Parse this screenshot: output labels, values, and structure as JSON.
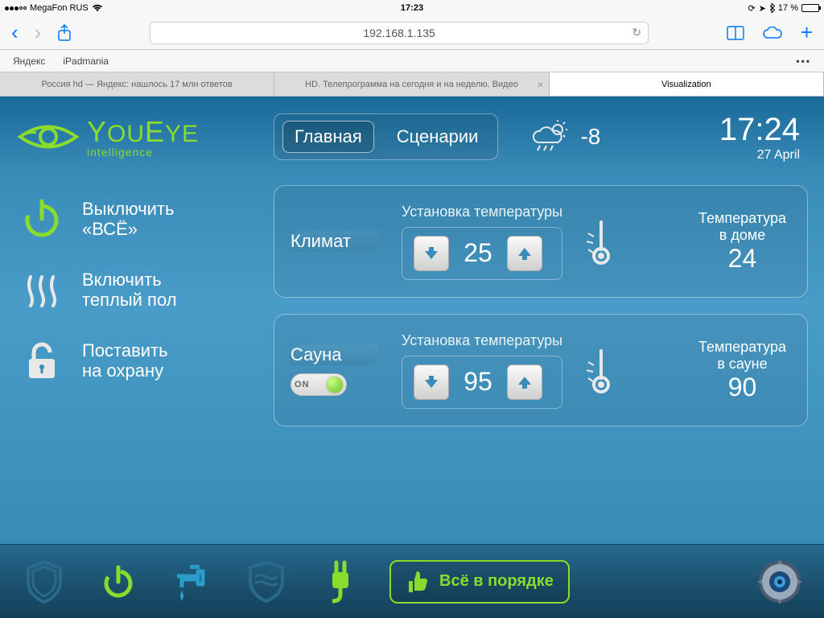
{
  "status_bar": {
    "carrier": "MegaFon RUS",
    "time": "17:23",
    "battery_pct": "17 %"
  },
  "safari": {
    "url": "192.168.1.135",
    "bookmarks": [
      "Яндекс",
      "iPadmania"
    ],
    "tabs": [
      {
        "title": "Россия hd — Яндекс: нашлось 17 млн ответов",
        "active": false
      },
      {
        "title": "HD. Телепрограмма на сегодня и на неделю. Видео",
        "active": false
      },
      {
        "title": "Visualization",
        "active": true
      }
    ]
  },
  "app": {
    "logo_top": "YouEye",
    "logo_sub": "intelligence",
    "nav": {
      "main": "Главная",
      "scenarios": "Сценарии"
    },
    "weather_temp": "-8",
    "clock_time": "17:24",
    "clock_date": "27 April",
    "sidebar": {
      "off_all_l1": "Выключить",
      "off_all_l2": "«ВСЁ»",
      "floor_l1": "Включить",
      "floor_l2": "теплый пол",
      "arm_l1": "Поставить",
      "arm_l2": "на охрану"
    },
    "climate": {
      "tab": "Климат",
      "setpoint_label": "Установка температуры",
      "setpoint": "25",
      "house_label1": "Температура",
      "house_label2": "в доме",
      "house_value": "24"
    },
    "sauna": {
      "tab": "Сауна",
      "toggle_label": "ON",
      "setpoint_label": "Установка температуры",
      "setpoint": "95",
      "label1": "Температура",
      "label2": "в сауне",
      "value": "90"
    },
    "status_ok": "Всё в порядке"
  }
}
